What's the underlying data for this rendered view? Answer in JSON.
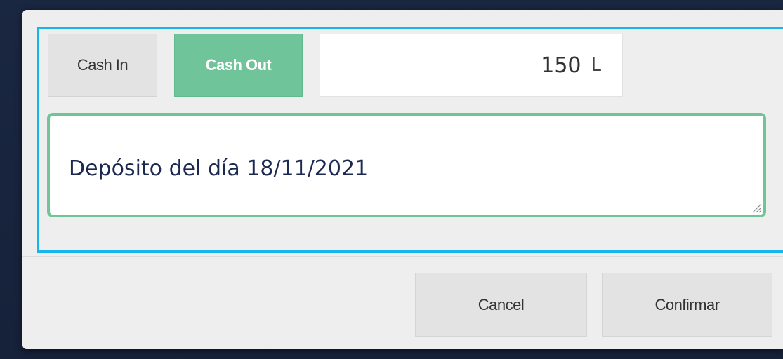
{
  "toggle": {
    "cash_in_label": "Cash In",
    "cash_out_label": "Cash Out",
    "selected": "Cash Out"
  },
  "amount": {
    "value": "150",
    "currency": "L"
  },
  "note": {
    "value": "Depósito del día 18/11/2021"
  },
  "footer": {
    "cancel_label": "Cancel",
    "confirm_label": "Confirmar"
  },
  "colors": {
    "accent_green": "#6fc49a",
    "highlight_blue": "#16b6ea",
    "backdrop": "#17233d"
  },
  "icons": {
    "resize_grip": "resize-grip-icon"
  }
}
